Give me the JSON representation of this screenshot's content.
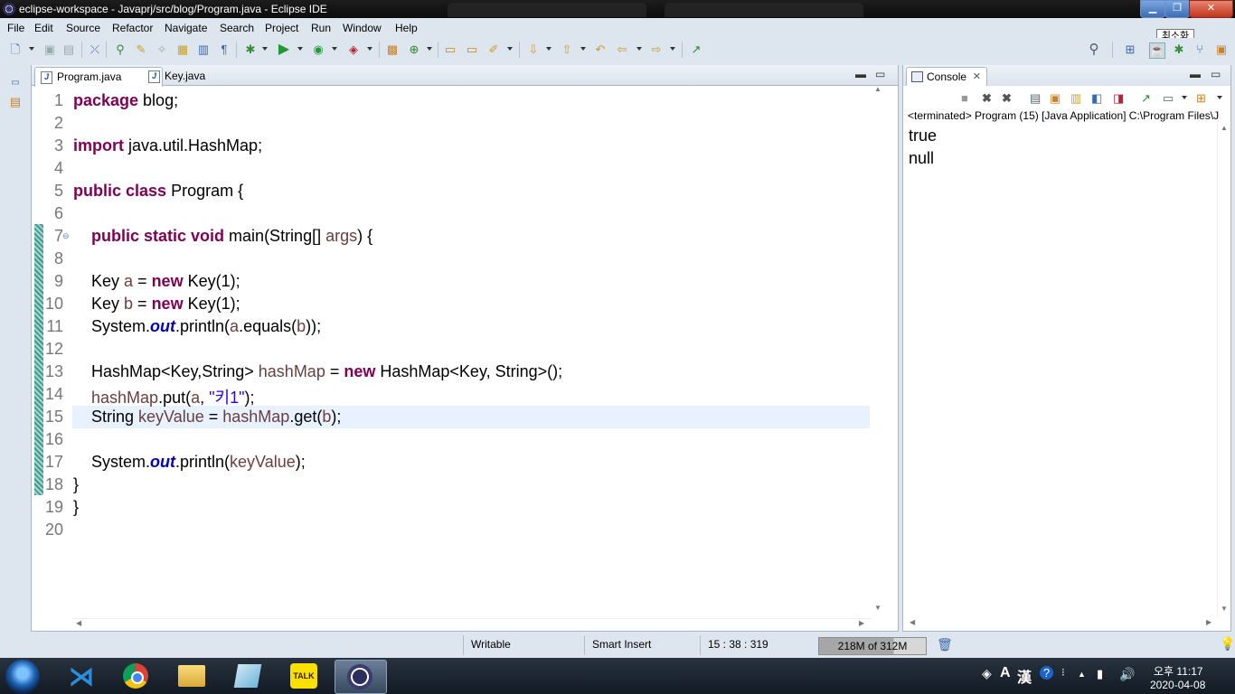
{
  "window": {
    "title": "eclipse-workspace - Javaprj/src/blog/Program.java - Eclipse IDE",
    "minimize_tooltip": "최소화",
    "min_glyph": "▁",
    "max_glyph": "❐",
    "close_glyph": "✕"
  },
  "menu": [
    "File",
    "Edit",
    "Source",
    "Refactor",
    "Navigate",
    "Search",
    "Project",
    "Run",
    "Window",
    "Help"
  ],
  "editor": {
    "tabs": [
      {
        "label": "Program.java",
        "active": true
      },
      {
        "label": "Key.java",
        "active": false
      }
    ],
    "line_numbers": [
      "1",
      "2",
      "3",
      "4",
      "5",
      "6",
      "7",
      "8",
      "9",
      "10",
      "11",
      "12",
      "13",
      "14",
      "15",
      "16",
      "17",
      "18",
      "19",
      "20"
    ],
    "code": {
      "l1_kw": "package",
      "l1_rest": " blog;",
      "l3_kw": "import",
      "l3_rest": " java.util.HashMap;",
      "l5_kw1": "public",
      "l5_kw2": "class",
      "l5_rest": " Program {",
      "l7_indent": "    ",
      "l7_kw": "public static void",
      "l7_a": " main(String[] ",
      "l7_var": "args",
      "l7_b": ") {",
      "l9_a": "    Key ",
      "l9_var": "a",
      "l9_b": " = ",
      "l9_kw": "new",
      "l9_c": " Key(1);",
      "l10_a": "    Key ",
      "l10_var": "b",
      "l10_b": " = ",
      "l10_kw": "new",
      "l10_c": " Key(1);",
      "l11_a": "    System.",
      "l11_fld": "out",
      "l11_b": ".println(",
      "l11_var1": "a",
      "l11_c": ".equals(",
      "l11_var2": "b",
      "l11_d": "));",
      "l13_a": "    HashMap<Key,String> ",
      "l13_var": "hashMap",
      "l13_b": " = ",
      "l13_kw": "new",
      "l13_c": " HashMap<Key, String>();",
      "l14_a": "    ",
      "l14_var1": "hashMap",
      "l14_b": ".put(",
      "l14_var2": "a",
      "l14_c": ", ",
      "l14_str": "\"키1\"",
      "l14_d": ");",
      "l15_a": "    String ",
      "l15_var1": "keyValue",
      "l15_b": " = ",
      "l15_var2": "hashMap",
      "l15_c": ".get(",
      "l15_var3": "b",
      "l15_d": ");",
      "l17_a": "    System.",
      "l17_fld": "out",
      "l17_b": ".println(",
      "l17_var": "keyValue",
      "l17_c": ");",
      "l18": "}",
      "l19": "}"
    }
  },
  "console": {
    "tab_label": "Console",
    "status": "<terminated> Program (15) [Java Application] C:\\Program Files\\J",
    "output": [
      "true",
      "null"
    ]
  },
  "statusbar": {
    "writable": "Writable",
    "insert_mode": "Smart Insert",
    "position": "15 : 38 : 319",
    "heap": "218M of 312M",
    "heap_used_fraction": 0.7
  },
  "taskbar": {
    "tray_lang": "A",
    "tray_hanja": "漢",
    "time": "오후 11:17",
    "date": "2020-04-08",
    "kakao_label": "TALK"
  },
  "colors": {
    "keyword": "#7f0055",
    "variable": "#6a3e3e",
    "field": "#0000c0",
    "string": "#2a00ff",
    "current_line": "#e8f2fe"
  }
}
